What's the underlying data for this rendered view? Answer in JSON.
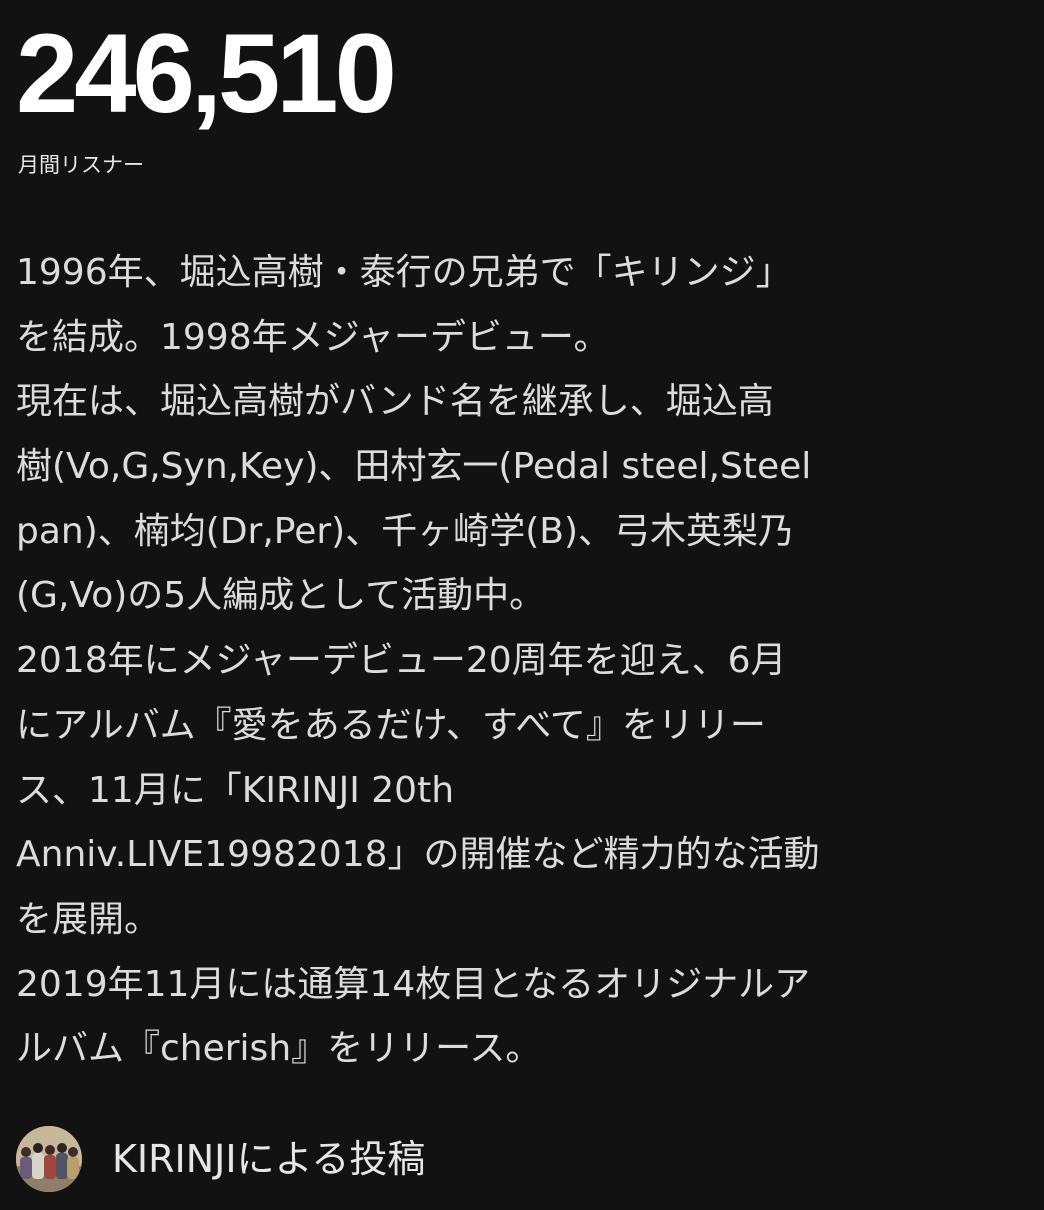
{
  "artist_stats": {
    "monthly_listeners": "246,510",
    "monthly_listeners_label": "月間リスナー"
  },
  "biography": {
    "lines": [
      "1996年、堀込高樹・泰行の兄弟で「キリンジ」",
      "を結成。1998年メジャーデビュー。",
      "現在は、堀込高樹がバンド名を継承し、堀込高",
      "樹(Vo,G,Syn,Key)、田村玄一(Pedal steel,Steel",
      "pan)、楠均(Dr,Per)、千ヶ崎学(B)、弓木英梨乃",
      "(G,Vo)の5人編成として活動中。",
      "2018年にメジャーデビュー20周年を迎え、6月",
      "にアルバム『愛をあるだけ、すべて』をリリー",
      "ス、11月に「KIRINJI 20th",
      "Anniv.LIVE19982018」の開催など精力的な活動",
      "を展開。",
      "2019年11月には通算14枚目となるオリジナルア",
      "ルバム『cherish』をリリース。"
    ]
  },
  "posted_by": {
    "text": "KIRINJIによる投稿",
    "avatar_icon": "artist-group-photo-avatar"
  }
}
